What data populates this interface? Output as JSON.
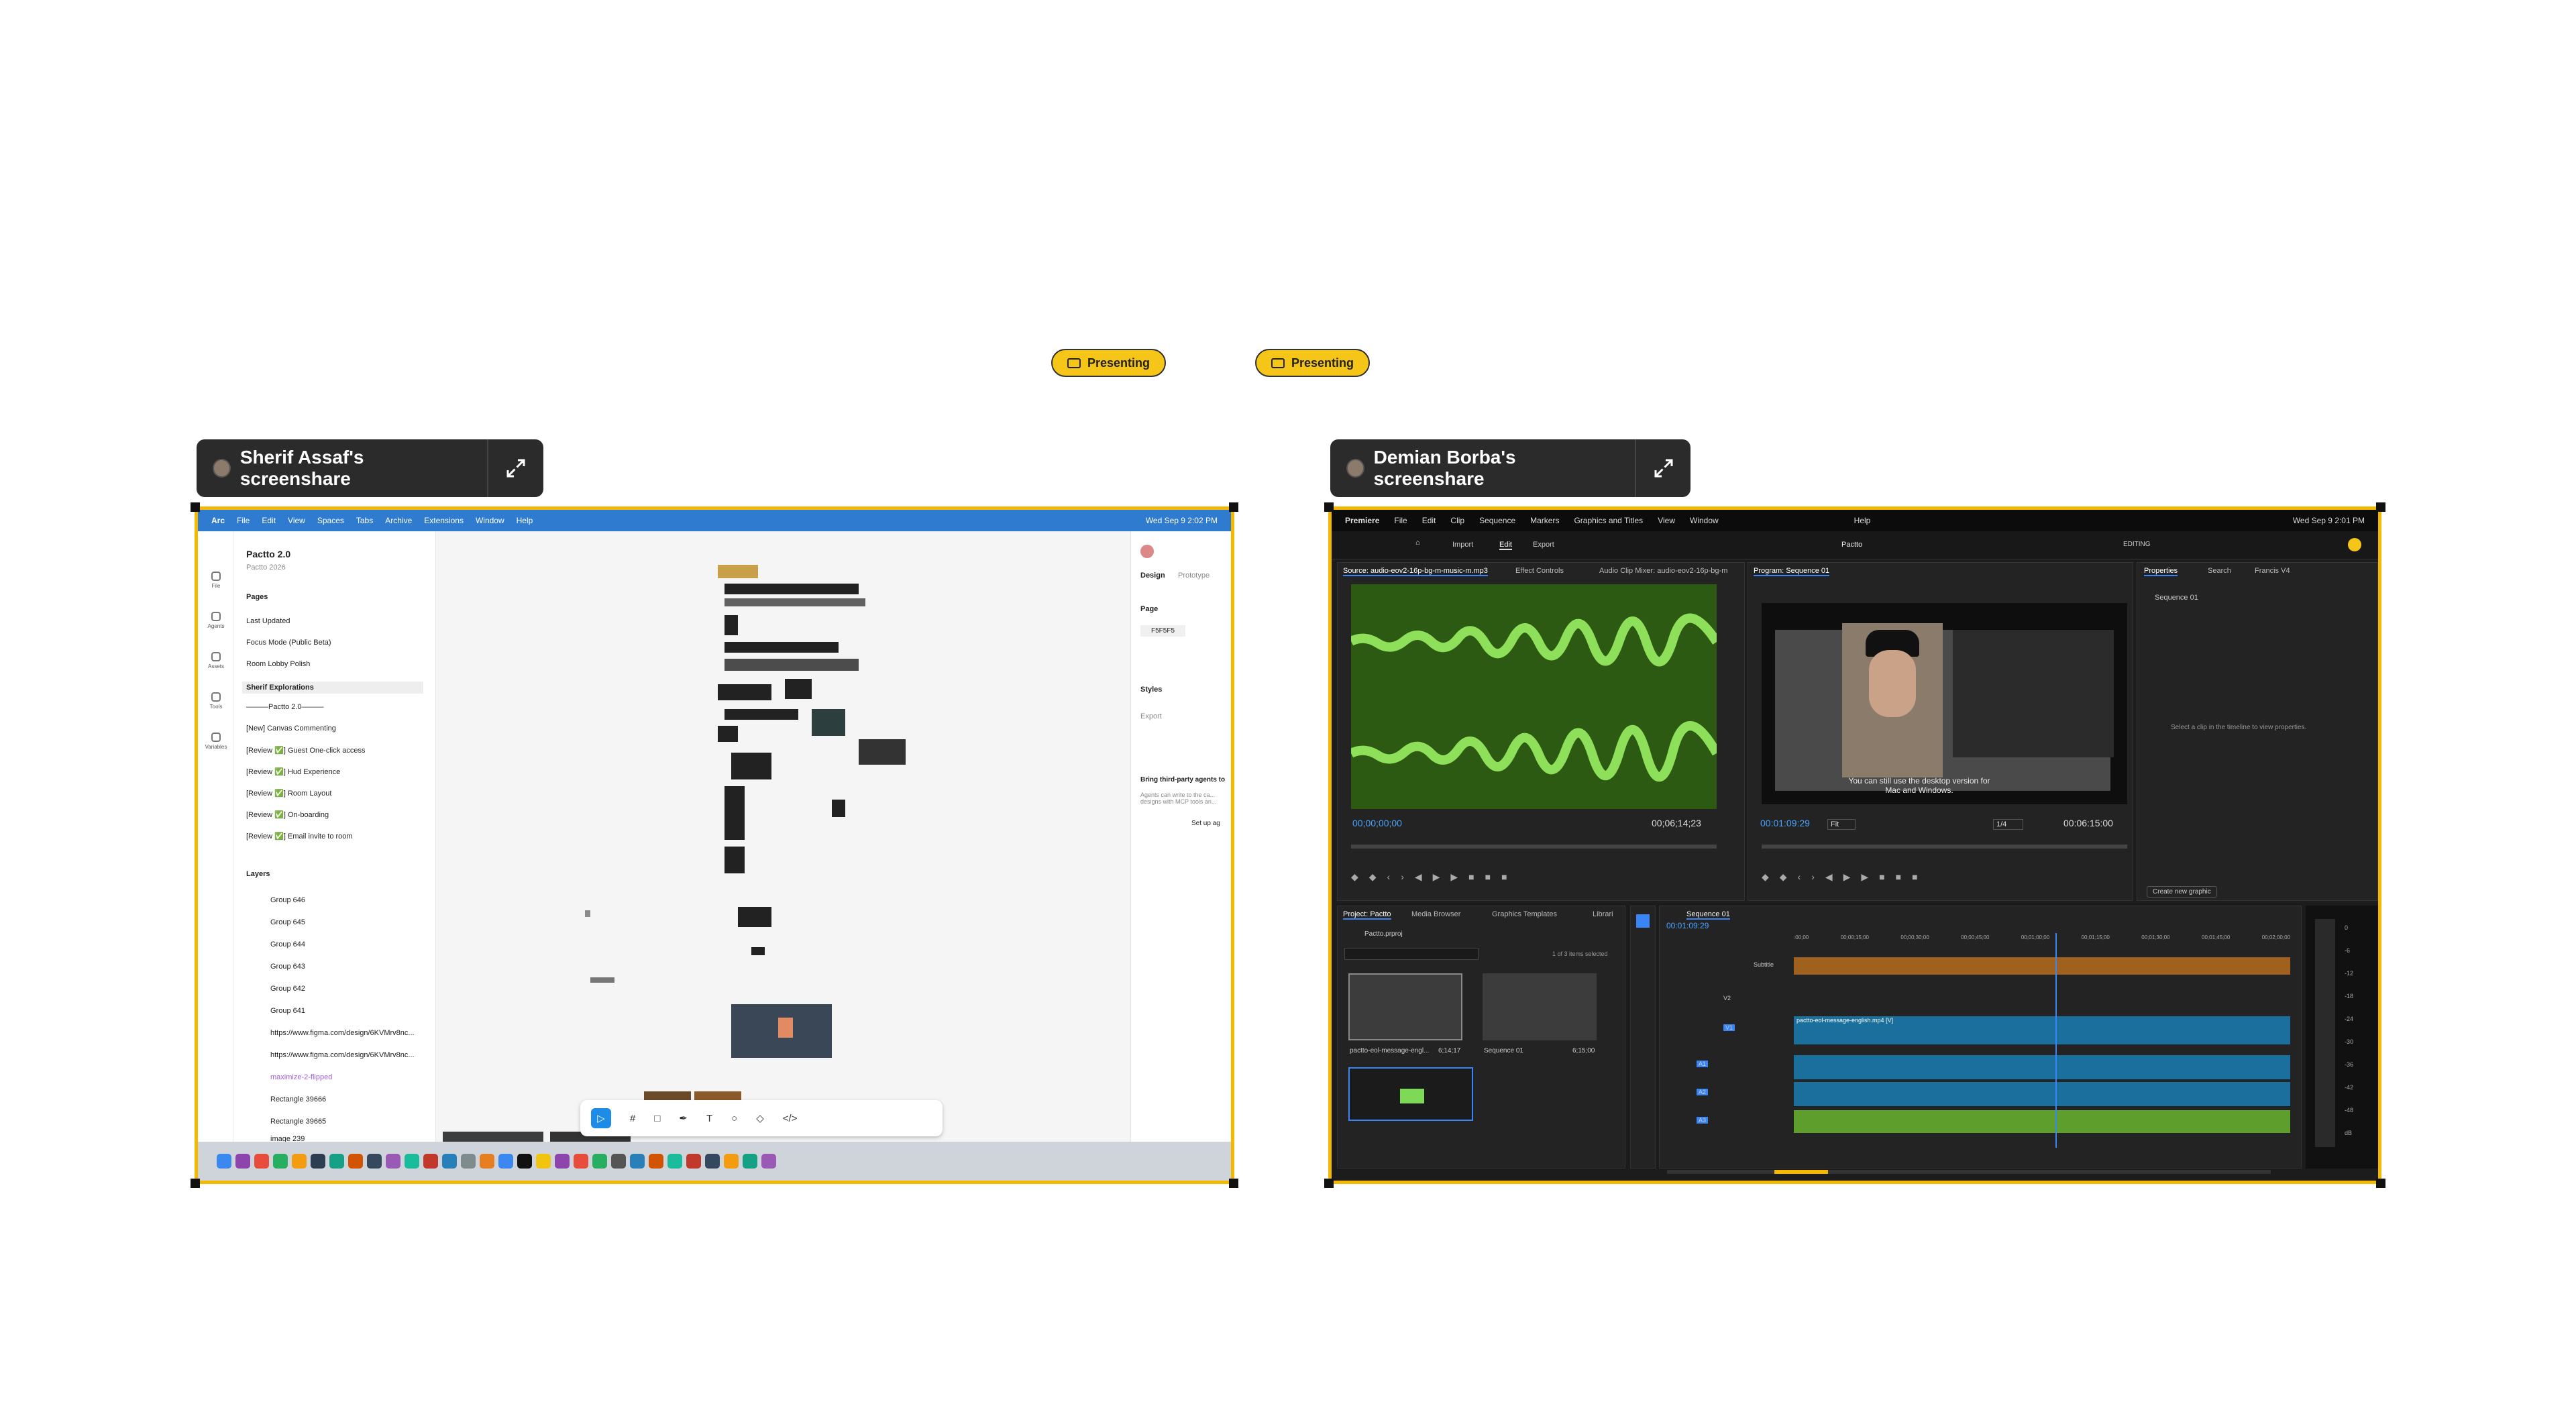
{
  "presenting_badges": [
    {
      "label": "Presenting"
    },
    {
      "label": "Presenting"
    }
  ],
  "screenshares": [
    {
      "owner_label": "Sherif Assaf's screenshare"
    },
    {
      "owner_label": "Demian Borba's screenshare"
    }
  ],
  "figma": {
    "menubar": {
      "items": [
        "Arc",
        "File",
        "Edit",
        "View",
        "Spaces",
        "Tabs",
        "Archive",
        "Extensions",
        "Window",
        "Help"
      ],
      "clock": "Wed Sep 9  2:02 PM"
    },
    "file_title": "Pactto 2.0",
    "file_sub": "Pactto 2026",
    "rail": [
      "File",
      "Agents",
      "Assets",
      "Tools",
      "Variables"
    ],
    "pages_header": "Pages",
    "pages": [
      "Last Updated",
      "Focus Mode (Public Beta)",
      "Room Lobby Polish",
      "Sherif Explorations",
      "———Pactto 2.0———",
      "[New] Canvas Commenting",
      "[Review ✅] Guest One-click access",
      "[Review ✅] Hud Experience",
      "[Review ✅] Room Layout",
      "[Review ✅] On-boarding",
      "[Review ✅] Email invite to room"
    ],
    "layers_header": "Layers",
    "layers": [
      "Group 646",
      "Group 645",
      "Group 644",
      "Group 643",
      "Group 642",
      "Group 641",
      "https://www.figma.com/design/6KVMrv8nc...",
      "https://www.figma.com/design/6KVMrv8nc...",
      "maximize-2-flipped",
      "Rectangle 39666",
      "Rectangle 39665",
      "image 239"
    ],
    "right": {
      "tabs": [
        "Design",
        "Prototype"
      ],
      "page_label": "Page",
      "page_color": "F5F5F5",
      "styles_label": "Styles",
      "export_label": "Export",
      "agents_title": "Bring third-party agents to",
      "agents_body": "Agents can write to the ca... designs with MCP tools an...",
      "setup": "Set up ag"
    }
  },
  "premiere": {
    "menubar": {
      "items": [
        "Premiere",
        "File",
        "Edit",
        "Clip",
        "Sequence",
        "Markers",
        "Graphics and Titles",
        "View",
        "Window",
        "Help"
      ],
      "clock": "Wed Sep 9  2:01 PM"
    },
    "header": {
      "tabs": [
        "Import",
        "Edit",
        "Export"
      ],
      "project": "Pactto",
      "mode": "EDITING"
    },
    "source": {
      "tabs": [
        "Source: audio-eov2-16p-bg-m-music-m.mp3",
        "Effect Controls",
        "Audio Clip Mixer: audio-eov2-16p-bg-m"
      ],
      "tc_in": "00;00;00;00",
      "tc_out": "00;06;14;23"
    },
    "program": {
      "tab": "Program: Sequence 01",
      "tc_in": "00:01:09:29",
      "fit": "Fit",
      "ratio": "1/4",
      "tc_out": "00:06:15:00",
      "caption": "You can still use the desktop version for Mac and Windows."
    },
    "properties": {
      "tabs": [
        "Properties",
        "Search",
        "Francis V4"
      ],
      "item": "Sequence 01",
      "hint": "Select a clip in the timeline to view properties.",
      "button": "Create new graphic"
    },
    "project_panel": {
      "tabs": [
        "Project: Pactto",
        "Media Browser",
        "Graphics Templates",
        "Librari"
      ],
      "file": "Pactto.prproj",
      "selected": "1 of 3 items selected",
      "items": [
        {
          "name": "pactto-eol-message-engl...",
          "dur": "6;14;17"
        },
        {
          "name": "Sequence 01",
          "dur": "6;15;00"
        }
      ]
    },
    "timeline": {
      "tab": "Sequence 01",
      "tc": "00:01:09:29",
      "ruler": [
        ":00;00",
        "00;00;15;00",
        "00;00;30;00",
        "00;00;45;00",
        "00;01;00;00",
        "00;01;15;00",
        "00;01;30;00",
        "00;01;45;00",
        "00;02;00;00"
      ],
      "tracks": [
        "Subtitle",
        "V2",
        "V1",
        "A1",
        "A2",
        "A3"
      ],
      "clip": "pactto-eol-message-english.mp4 [V]"
    },
    "meter_ticks": [
      "0",
      "-6",
      "-12",
      "-18",
      "-24",
      "-30",
      "-36",
      "-42",
      "-48",
      "dB"
    ]
  },
  "colors": {
    "presenting": "#f5c518",
    "frame": "#f5b800",
    "figma_bar": "#2f7bd0",
    "waveform": "#7ed957",
    "clip_blue": "#1a6f9c",
    "clip_orange": "#a0601e"
  }
}
